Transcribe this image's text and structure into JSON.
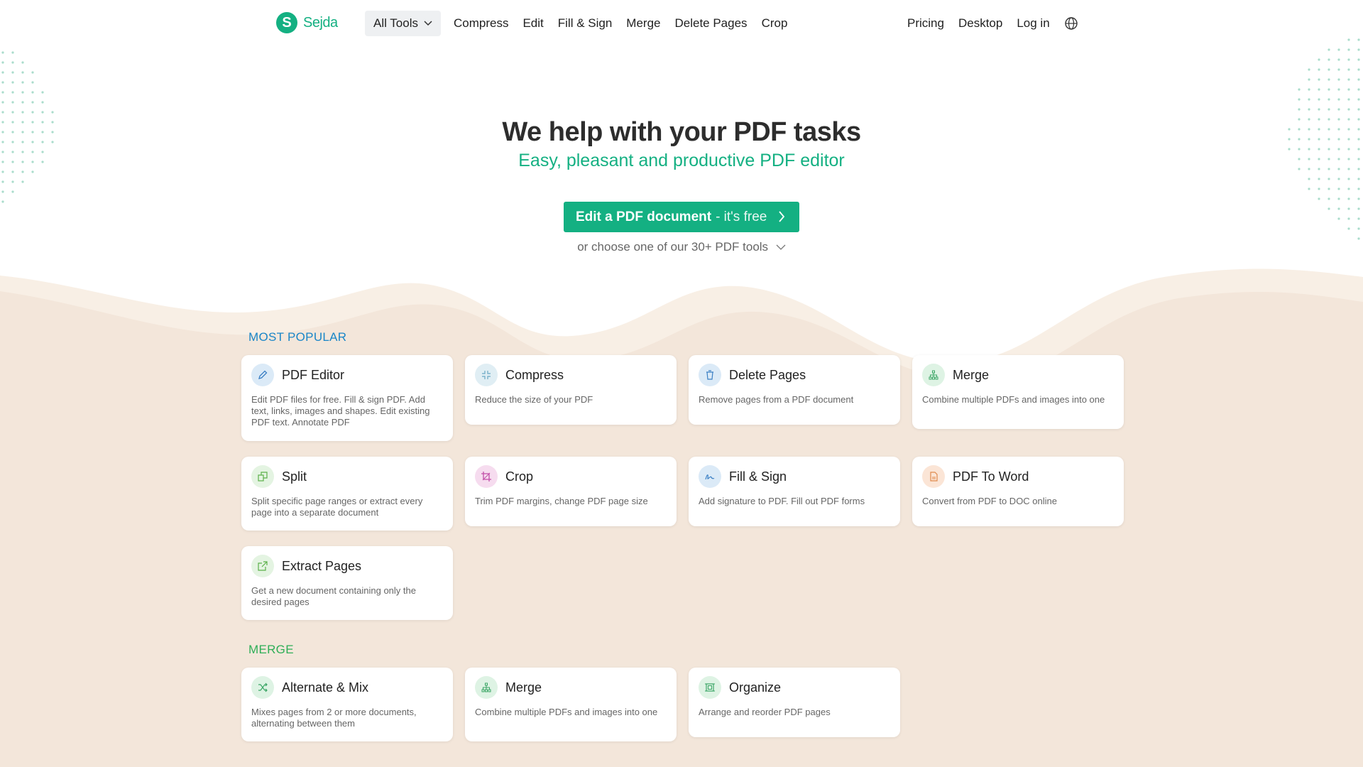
{
  "header": {
    "logo_text": "Sejda",
    "all_tools": "All Tools",
    "nav": [
      "Compress",
      "Edit",
      "Fill & Sign",
      "Merge",
      "Delete Pages",
      "Crop"
    ],
    "right": [
      "Pricing",
      "Desktop",
      "Log in"
    ]
  },
  "hero": {
    "title": "We help with your PDF tasks",
    "subtitle": "Easy, pleasant and productive PDF editor",
    "cta_main": "Edit a PDF document",
    "cta_suffix": "- it's free",
    "choose": "or choose one of our 30+ PDF tools"
  },
  "colors": {
    "brand": "#14b082",
    "section_blue": "#1a86c8",
    "section_green": "#2fae57",
    "bg_sand": "#f3e6da"
  },
  "sections": [
    {
      "title": "MOST POPULAR",
      "cards": [
        {
          "title": "PDF Editor",
          "desc": "Edit PDF files for free. Fill & sign PDF. Add text, links, images and shapes. Edit existing PDF text. Annotate PDF",
          "icon": "pencil-icon"
        },
        {
          "title": "Compress",
          "desc": "Reduce the size of your PDF",
          "icon": "compress-icon"
        },
        {
          "title": "Delete Pages",
          "desc": "Remove pages from a PDF document",
          "icon": "trash-icon"
        },
        {
          "title": "Merge",
          "desc": "Combine multiple PDFs and images into one",
          "icon": "merge-icon"
        },
        {
          "title": "Split",
          "desc": "Split specific page ranges or extract every page into a separate document",
          "icon": "split-icon"
        },
        {
          "title": "Crop",
          "desc": "Trim PDF margins, change PDF page size",
          "icon": "crop-icon"
        },
        {
          "title": "Fill & Sign",
          "desc": "Add signature to PDF. Fill out PDF forms",
          "icon": "signature-icon"
        },
        {
          "title": "PDF To Word",
          "desc": "Convert from PDF to DOC online",
          "icon": "document-icon"
        },
        {
          "title": "Extract Pages",
          "desc": "Get a new document containing only the desired pages",
          "icon": "external-link-icon"
        }
      ]
    },
    {
      "title": "MERGE",
      "cards": [
        {
          "title": "Alternate & Mix",
          "desc": "Mixes pages from 2 or more documents, alternating between them",
          "icon": "shuffle-icon"
        },
        {
          "title": "Merge",
          "desc": "Combine multiple PDFs and images into one",
          "icon": "merge-icon"
        },
        {
          "title": "Organize",
          "desc": "Arrange and reorder PDF pages",
          "icon": "organize-icon"
        }
      ]
    }
  ]
}
